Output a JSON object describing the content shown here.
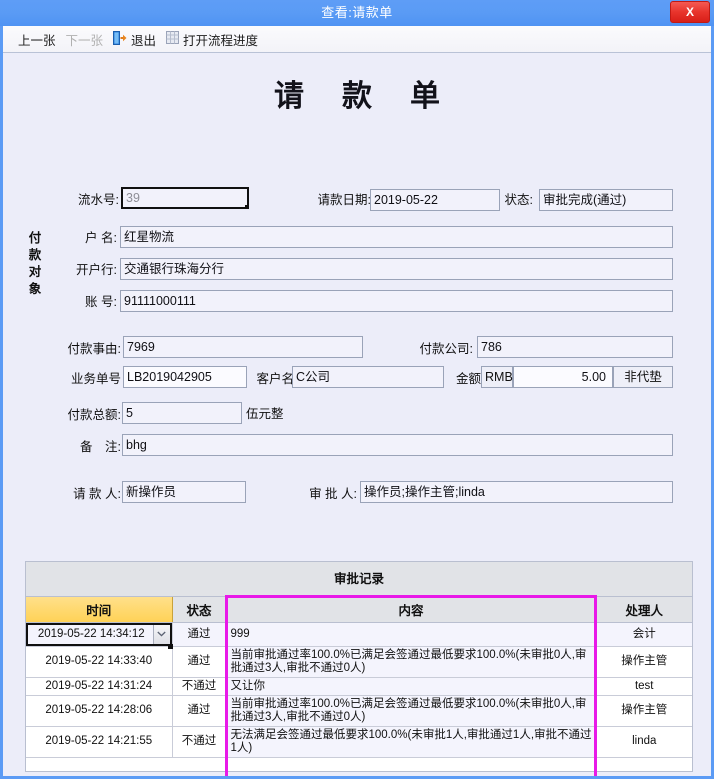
{
  "window": {
    "title": "查看:请款单",
    "close_label": "X",
    "accent_blue": "#5b9bf5",
    "body_bg": "#ecedf9"
  },
  "toolbar": {
    "items": [
      {
        "label": "上一张",
        "icon": null,
        "disabled": false
      },
      {
        "label": "下一张",
        "icon": null,
        "disabled": true
      },
      {
        "label": "退出",
        "icon": "exit-icon",
        "disabled": false
      },
      {
        "label": "打开流程进度",
        "icon": "grid-icon",
        "disabled": false
      }
    ]
  },
  "form": {
    "title": "请款单",
    "serial": {
      "label": "流水号:",
      "value": "39"
    },
    "request_date": {
      "label": "请款日期:",
      "value": "2019-05-22"
    },
    "status": {
      "label": "状态:",
      "value": "审批完成(通过)"
    },
    "payee_group_label": "付款对象",
    "account_name": {
      "label": "户 名:",
      "value": "红星物流"
    },
    "bank": {
      "label": "开户行:",
      "value": "交通银行珠海分行"
    },
    "account_no": {
      "label": "账 号:",
      "value": "91111000111"
    },
    "reason": {
      "label": "付款事由:",
      "value": "7969"
    },
    "pay_company": {
      "label": "付款公司:",
      "value": "786"
    },
    "business_no": {
      "label": "业务单号",
      "value": "LB2019042905"
    },
    "customer": {
      "label": "客户名",
      "value": "C公司"
    },
    "amount": {
      "label": "金额",
      "currency": "RMB",
      "value": "5.00",
      "flag": "非代垫"
    },
    "total": {
      "label": "付款总额:",
      "value": "5",
      "in_words": "伍元整"
    },
    "remark": {
      "label": "备　注:",
      "value": "bhg"
    },
    "requester": {
      "label": "请 款 人:",
      "value": "新操作员"
    },
    "approvers": {
      "label": "审 批 人:",
      "value": "操作员;操作主管;linda"
    }
  },
  "approval_table": {
    "caption": "审批记录",
    "columns": [
      "时间",
      "状态",
      "内容",
      "处理人"
    ],
    "highlight_color": "#e819e8",
    "rows": [
      {
        "time": "2019-05-22 14:34:12",
        "state": "通过",
        "content": "999",
        "handler": "会计",
        "is_combo": true
      },
      {
        "time": "2019-05-22 14:33:40",
        "state": "通过",
        "content": "当前审批通过率100.0%已满足会签通过最低要求100.0%(未审批0人,审批通过3人,审批不通过0人)",
        "handler": "操作主管",
        "is_combo": false
      },
      {
        "time": "2019-05-22 14:31:24",
        "state": "不通过",
        "content": "又让你",
        "handler": "test",
        "is_combo": false
      },
      {
        "time": "2019-05-22 14:28:06",
        "state": "通过",
        "content": "当前审批通过率100.0%已满足会签通过最低要求100.0%(未审批0人,审批通过3人,审批不通过0人)",
        "handler": "操作主管",
        "is_combo": false
      },
      {
        "time": "2019-05-22 14:21:55",
        "state": "不通过",
        "content": "无法满足会签通过最低要求100.0%(未审批1人,审批通过1人,审批不通过1人)",
        "handler": "linda",
        "is_combo": false
      }
    ]
  }
}
